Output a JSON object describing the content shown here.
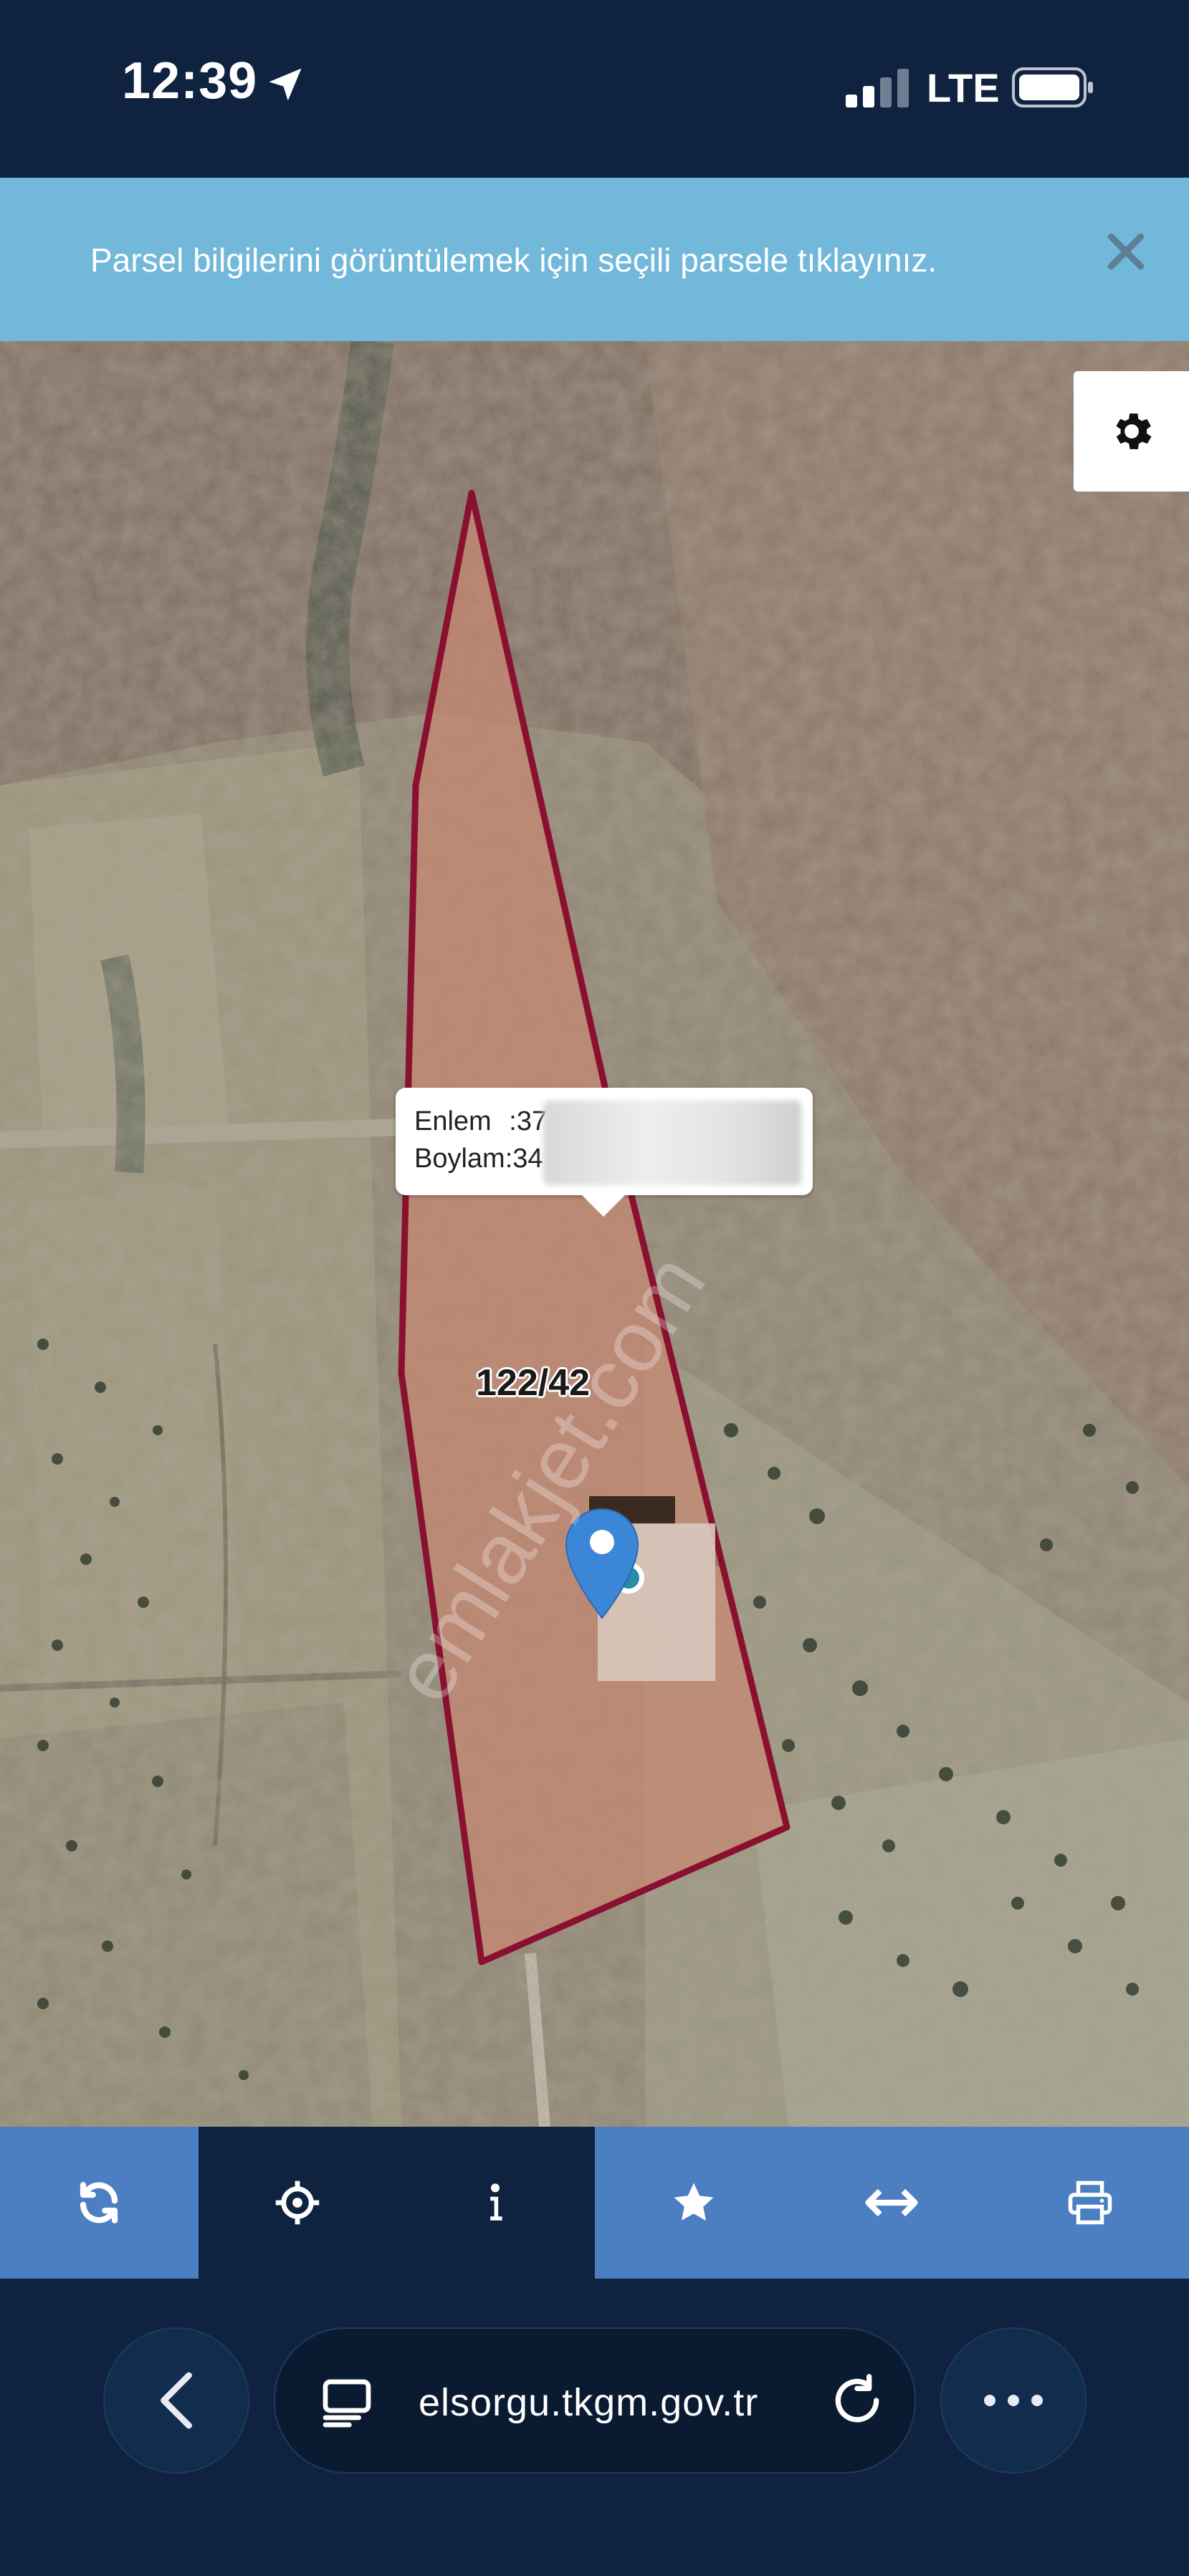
{
  "status_bar": {
    "time": "12:39",
    "network": "LTE"
  },
  "banner": {
    "message": "Parsel bilgilerini görüntülemek için seçili parsele tıklayınız.",
    "close_icon": "close-icon"
  },
  "map": {
    "settings_icon": "gear-icon",
    "popup": {
      "lat_label": "Enlem",
      "lat_value": ":37",
      "lon_label": "Boylam:",
      "lon_value": "34"
    },
    "parcel_label": "122/42",
    "watermark": "emlakjet.com",
    "parcel_outline_color": "#8a1030",
    "parcel_fill_color": "#c88872",
    "marker_color": "#3b86d6"
  },
  "toolbar": {
    "items": [
      {
        "icon": "refresh-icon"
      },
      {
        "icon": "crosshair-icon"
      },
      {
        "icon": "info-icon"
      },
      {
        "icon": "star-icon"
      },
      {
        "icon": "measure-icon"
      },
      {
        "icon": "print-icon"
      }
    ],
    "accent_color": "#4b7fc1"
  },
  "browser": {
    "url": "elsorgu.tkgm.gov.tr",
    "back_icon": "chevron-left-icon",
    "reload_icon": "reload-icon",
    "more_icon": "more-icon"
  }
}
